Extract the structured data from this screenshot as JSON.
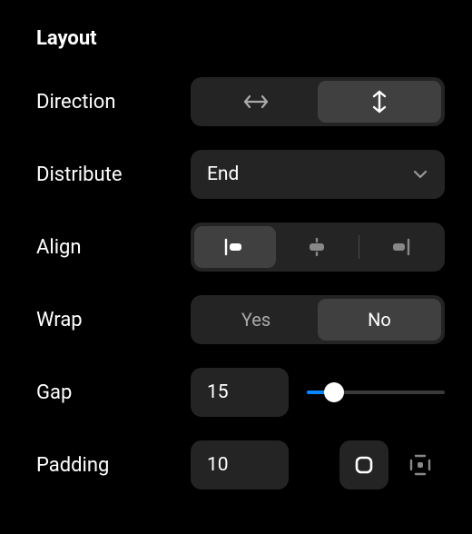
{
  "section": {
    "title": "Layout"
  },
  "direction": {
    "label": "Direction",
    "options": [
      {
        "id": "horizontal",
        "icon": "arrow-left-right-icon",
        "selected": false
      },
      {
        "id": "vertical",
        "icon": "arrow-up-down-icon",
        "selected": true
      }
    ]
  },
  "distribute": {
    "label": "Distribute",
    "value": "End"
  },
  "align": {
    "label": "Align",
    "options": [
      {
        "id": "start",
        "icon": "align-start-icon",
        "selected": true
      },
      {
        "id": "center",
        "icon": "align-center-icon",
        "selected": false
      },
      {
        "id": "end",
        "icon": "align-end-icon",
        "selected": false
      }
    ]
  },
  "wrap": {
    "label": "Wrap",
    "options": [
      {
        "id": "yes",
        "text": "Yes",
        "selected": false
      },
      {
        "id": "no",
        "text": "No",
        "selected": true
      }
    ]
  },
  "gap": {
    "label": "Gap",
    "value": "15",
    "slider": {
      "percent": 20
    }
  },
  "padding": {
    "label": "Padding",
    "value": "10",
    "mode_options": [
      {
        "id": "uniform",
        "icon": "padding-uniform-icon",
        "selected": true
      },
      {
        "id": "individual",
        "icon": "padding-individual-icon",
        "selected": false
      }
    ]
  }
}
